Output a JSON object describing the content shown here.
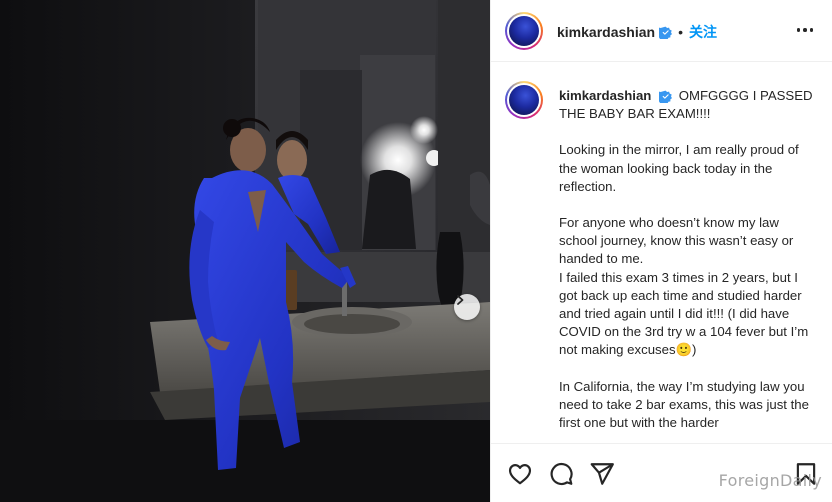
{
  "post": {
    "username": "kimkardashian",
    "follow_label": "关注",
    "dot": "•"
  },
  "caption": {
    "username": "kimkardashian",
    "headline": "OMFGGGG I PASSED THE BABY BAR EXAM!!!!",
    "paragraphs": [
      "Looking in the mirror, I am really proud of the woman looking back today in the reflection.",
      "For anyone who doesn’t know my law school journey, know this wasn’t easy or handed to me.\nI failed this exam 3 times in 2 years, but I got back up each time and studied harder and tried again until I did it!!! (I did have COVID on the 3rd try w a 104 fever but I’m not making excuses🙂)",
      "In California, the way I’m studying law you need to take 2 bar exams, this was just the first one but with the harder"
    ]
  },
  "icons": {
    "verified": "verified-badge-icon",
    "more": "more-options-icon",
    "carousel_next": "chevron-right-icon",
    "like": "heart-icon",
    "comment": "comment-icon",
    "share": "paper-plane-icon",
    "save": "bookmark-icon"
  },
  "watermark": "ForeignDaily",
  "colors": {
    "accent_blue": "#0095f6",
    "verified_blue": "#3897f0",
    "dress_blue": "#2b3fd6",
    "photo_background": "#141416"
  }
}
